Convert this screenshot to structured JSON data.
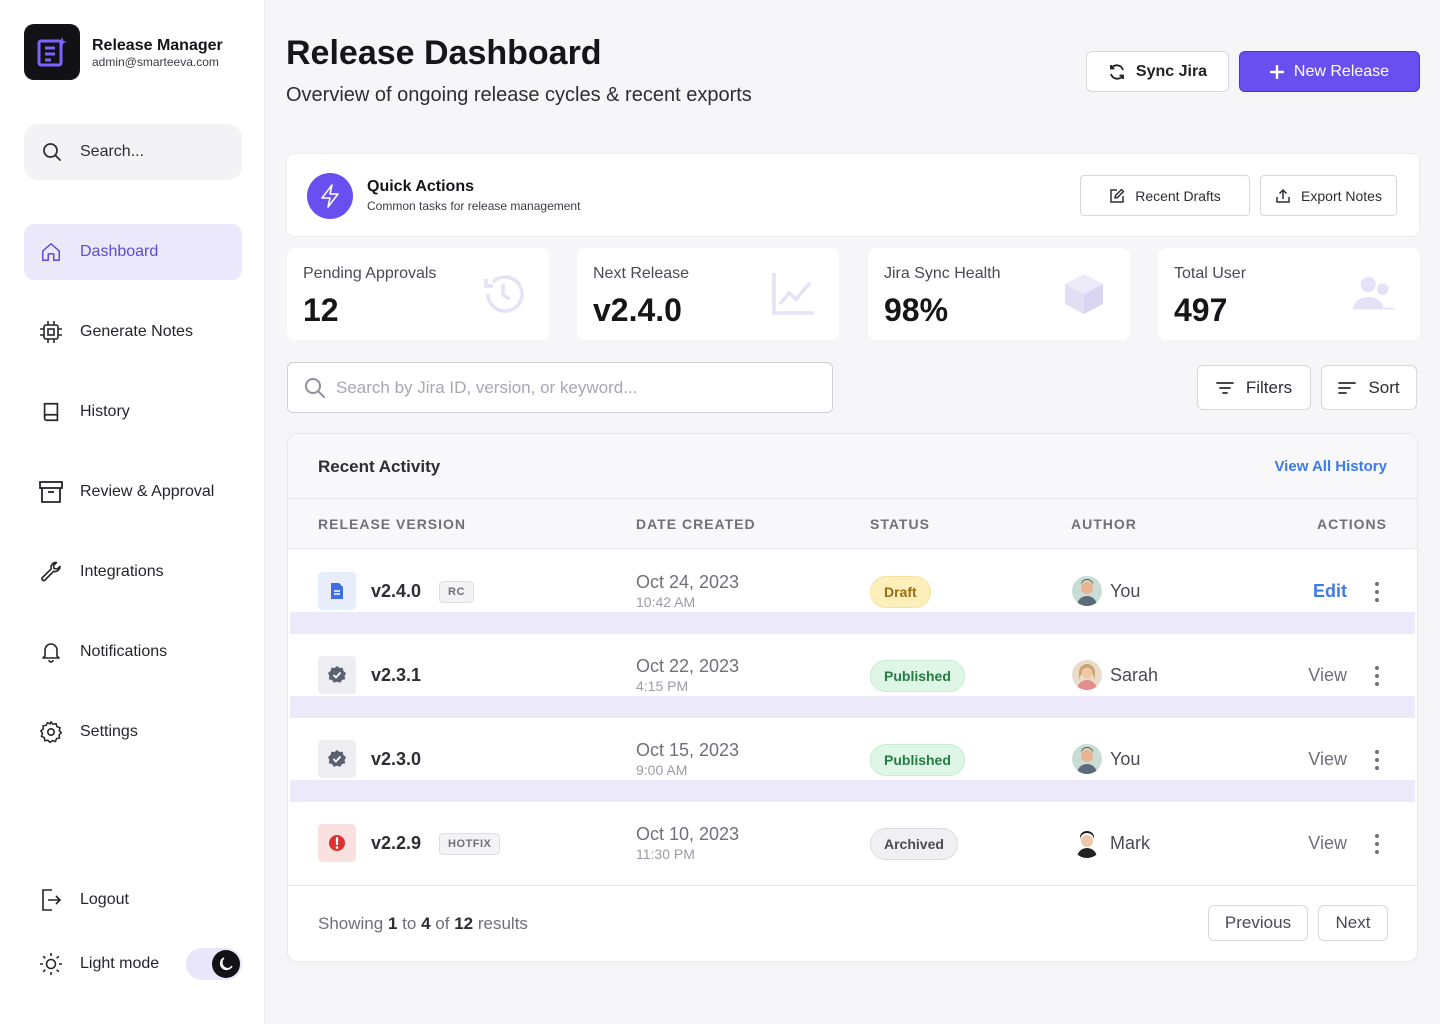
{
  "app": {
    "name": "Release Manager",
    "email": "admin@smarteeva.com"
  },
  "sidebar": {
    "search_label": "Search...",
    "items": [
      {
        "label": "Dashboard",
        "icon": "home-icon",
        "active": true
      },
      {
        "label": "Generate Notes",
        "icon": "cpu-chip-icon"
      },
      {
        "label": "History",
        "icon": "book-icon"
      },
      {
        "label": "Review & Approval",
        "icon": "archive-box-icon"
      },
      {
        "label": "Integrations",
        "icon": "wrench-icon"
      },
      {
        "label": "Notifications",
        "icon": "bell-icon"
      },
      {
        "label": "Settings",
        "icon": "gear-icon"
      }
    ],
    "logout_label": "Logout",
    "theme_label": "Light mode"
  },
  "header": {
    "title": "Release Dashboard",
    "subtitle": "Overview of ongoing release cycles & recent exports",
    "sync_label": "Sync Jira",
    "new_label": "New Release"
  },
  "quick_actions": {
    "title": "Quick Actions",
    "subtitle": "Common tasks for release management",
    "drafts_label": "Recent Drafts",
    "export_label": "Export Notes"
  },
  "stats": [
    {
      "label": "Pending Approvals",
      "value": "12",
      "icon": "clock-history-icon"
    },
    {
      "label": "Next Release",
      "value": "v2.4.0",
      "icon": "line-chart-icon"
    },
    {
      "label": "Jira Sync Health",
      "value": "98%",
      "icon": "cube-icon"
    },
    {
      "label": "Total User",
      "value": "497",
      "icon": "users-icon"
    }
  ],
  "search": {
    "placeholder": "Search by Jira ID, version, or keyword..."
  },
  "filters_label": "Filters",
  "sort_label": "Sort",
  "activity": {
    "title": "Recent Activity",
    "view_all": "View All History",
    "columns": [
      "RELEASE VERSION",
      "DATE CREATED",
      "STATUS",
      "AUTHOR",
      "ACTIONS"
    ],
    "rows": [
      {
        "version": "v2.4.0",
        "tag": "RC",
        "date": "Oct 24, 2023",
        "time": "10:42 AM",
        "status": "Draft",
        "author": "You",
        "action": "Edit",
        "icon": "document-icon"
      },
      {
        "version": "v2.3.1",
        "tag": "",
        "date": "Oct 22, 2023",
        "time": "4:15 PM",
        "status": "Published",
        "author": "Sarah",
        "action": "View",
        "icon": "verified-badge-icon"
      },
      {
        "version": "v2.3.0",
        "tag": "",
        "date": "Oct 15, 2023",
        "time": "9:00 AM",
        "status": "Published",
        "author": "You",
        "action": "View",
        "icon": "verified-badge-icon"
      },
      {
        "version": "v2.2.9",
        "tag": "HOTFIX",
        "date": "Oct 10, 2023",
        "time": "11:30 PM",
        "status": "Archived",
        "author": "Mark",
        "action": "View",
        "icon": "alert-icon"
      }
    ],
    "footer": {
      "prefix": "Showing",
      "from": "1",
      "to_word": "to",
      "to": "4",
      "of_word": "of",
      "total": "12",
      "suffix": "results"
    },
    "prev_label": "Previous",
    "next_label": "Next"
  },
  "colors": {
    "accent": "#6a4ff0",
    "link": "#3d7be8",
    "active_bg": "#ebe8fb"
  }
}
